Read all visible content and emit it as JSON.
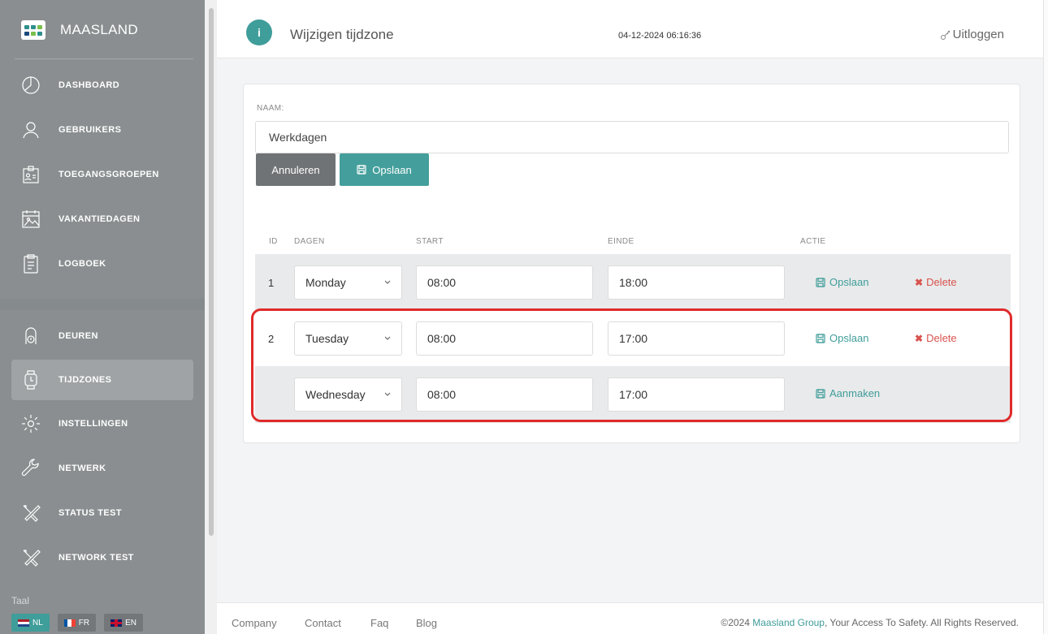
{
  "brand": {
    "name": "MAASLAND"
  },
  "sidebar": {
    "items": [
      {
        "label": "DASHBOARD"
      },
      {
        "label": "GEBRUIKERS"
      },
      {
        "label": "TOEGANGSGROEPEN"
      },
      {
        "label": "VAKANTIEDAGEN"
      },
      {
        "label": "LOGBOEK"
      },
      {
        "label": "DEUREN"
      },
      {
        "label": "TIJDZONES"
      },
      {
        "label": "INSTELLINGEN"
      },
      {
        "label": "NETWERK"
      },
      {
        "label": "STATUS TEST"
      },
      {
        "label": "NETWORK TEST"
      }
    ],
    "active": "TIJDZONES",
    "taal_label": "Taal",
    "languages": [
      {
        "code": "NL",
        "active": true
      },
      {
        "code": "FR",
        "active": false
      },
      {
        "code": "EN",
        "active": false
      }
    ]
  },
  "header": {
    "title": "Wijzigen tijdzone",
    "datetime": "04-12-2024 06:16:36",
    "logout_label": "Uitloggen"
  },
  "form": {
    "naam_label": "NAAM:",
    "naam_value": "Werkdagen",
    "cancel_label": "Annuleren",
    "save_label": "Opslaan"
  },
  "table": {
    "headers": {
      "id": "ID",
      "dagen": "DAGEN",
      "start": "START",
      "einde": "EINDE",
      "actie": "ACTIE"
    },
    "rows": [
      {
        "id": "1",
        "day": "Monday",
        "start": "08:00",
        "end": "18:00",
        "save_label": "Opslaan",
        "delete_label": "Delete"
      },
      {
        "id": "2",
        "day": "Tuesday",
        "start": "08:00",
        "end": "17:00",
        "save_label": "Opslaan",
        "delete_label": "Delete"
      }
    ],
    "new_row": {
      "day": "Wednesday",
      "start": "08:00",
      "end": "17:00",
      "create_label": "Aanmaken"
    }
  },
  "footer": {
    "links": [
      "Company",
      "Contact",
      "Faq",
      "Blog"
    ],
    "copyright_prefix": "©2024 ",
    "copyright_link": "Maasland Group",
    "copyright_suffix": ", Your Access To Safety. All Rights Reserved."
  },
  "colors": {
    "accent": "#3f9d9a",
    "sidebar": "#8a8e90",
    "danger": "#d9534f",
    "highlight": "#e02a2a"
  }
}
